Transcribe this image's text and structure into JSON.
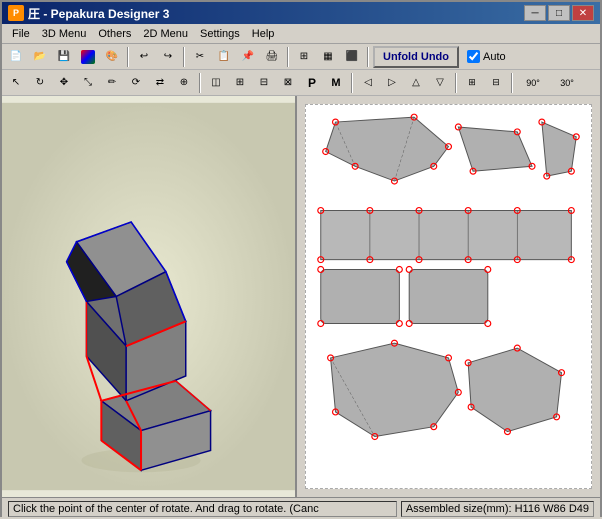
{
  "window": {
    "title": "圧 - Pepakura Designer 3",
    "title_icon": "P"
  },
  "title_buttons": {
    "minimize": "─",
    "maximize": "□",
    "close": "✕"
  },
  "menu": {
    "items": [
      "File",
      "3D Menu",
      "Others",
      "2D Menu",
      "Settings",
      "Help"
    ]
  },
  "toolbar1": {
    "unfold_undo_label": "Unfold Undo",
    "auto_label": "Auto",
    "auto_checked": true
  },
  "status_bar": {
    "left_text": "Click the point of the center of rotate. And drag to rotate. (Canc",
    "right_text": "Assembled size(mm): H116 W86 D49"
  }
}
